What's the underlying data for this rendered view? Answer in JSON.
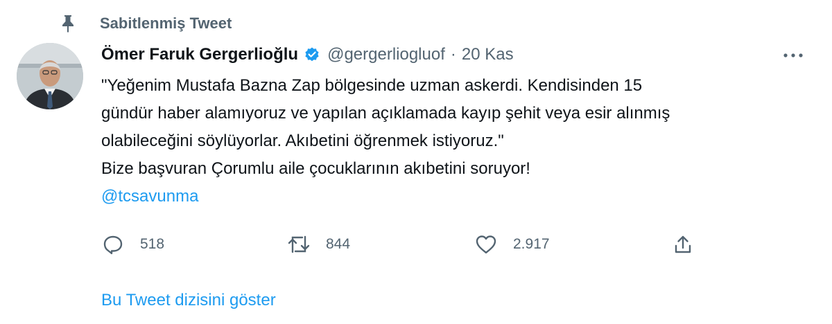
{
  "pinned": {
    "label": "Sabitlenmiş Tweet",
    "icon": "pin-icon"
  },
  "author": {
    "name": "Ömer Faruk Gergerlioğlu",
    "verified_icon": "verified-badge-icon",
    "handle": "@gergerliogluof",
    "separator": "·",
    "date": "20 Kas"
  },
  "menu": {
    "icon": "more-options-icon"
  },
  "tweet": {
    "lines": [
      "\"Yeğenim Mustafa Bazna Zap bölgesinde uzman askerdi. Kendisinden 15",
      "gündür haber alamıyoruz ve yapılan açıklamada kayıp şehit veya esir alınmış",
      "olabileceğini söylüyorlar. Akıbetini öğrenmek istiyoruz.\"",
      "Bize başvuran Çorumlu aile çocuklarının akıbetini soruyor!"
    ],
    "mention": "@tcsavunma"
  },
  "actions": {
    "reply": {
      "icon": "reply-icon",
      "count": "518"
    },
    "retweet": {
      "icon": "retweet-icon",
      "count": "844"
    },
    "like": {
      "icon": "heart-icon",
      "count": "2.917"
    },
    "share": {
      "icon": "share-icon"
    }
  },
  "thread_link": "Bu Tweet dizisini göster",
  "colors": {
    "accent": "#1d9bf0",
    "secondary_text": "#536471",
    "primary_text": "#0f1419"
  }
}
